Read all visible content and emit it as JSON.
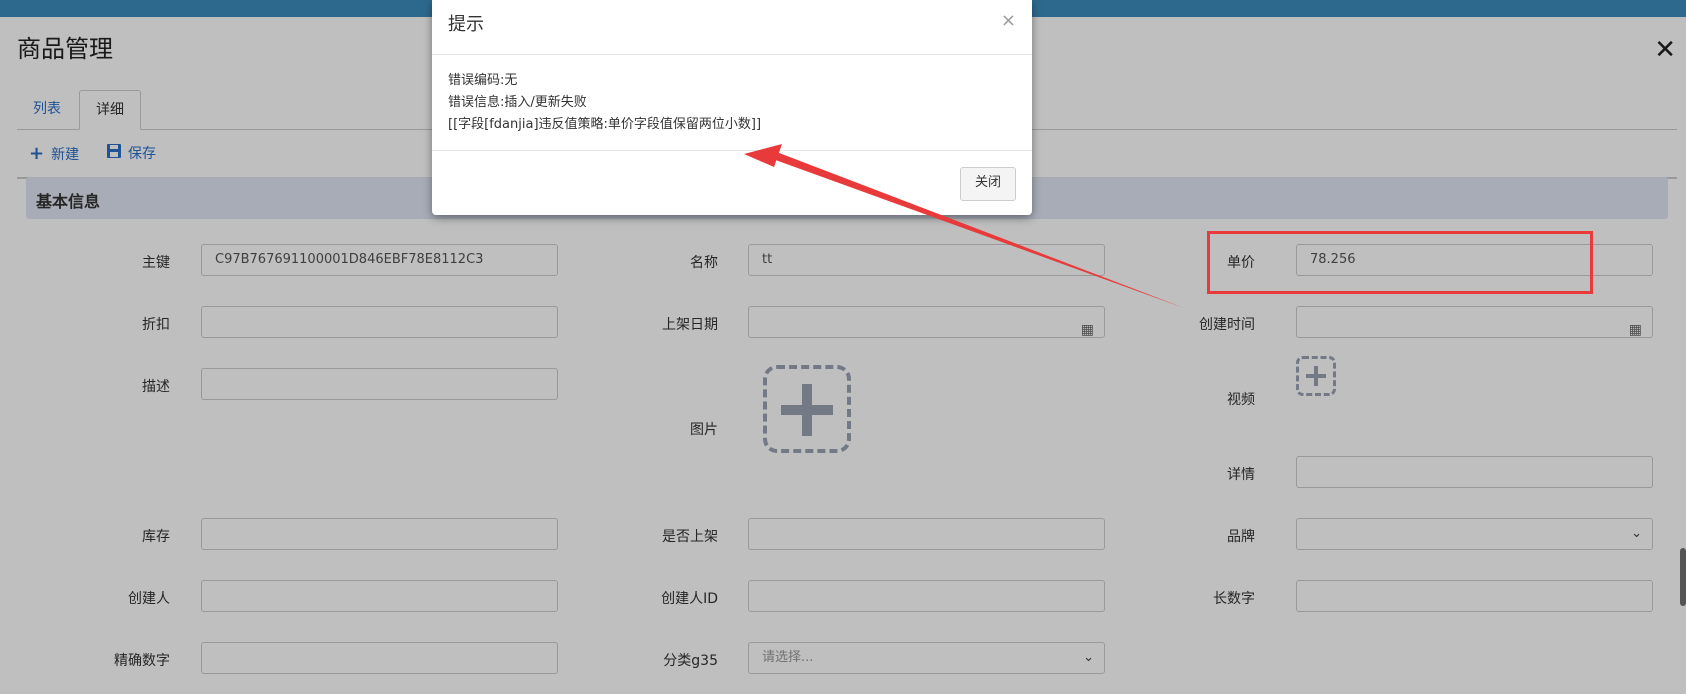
{
  "page": {
    "title": "商品管理",
    "close": "✕"
  },
  "tabs": [
    {
      "label": "列表",
      "active": false
    },
    {
      "label": "详细",
      "active": true
    }
  ],
  "toolbar": {
    "new_icon": "+",
    "new_label": "新建",
    "save_icon": "💾",
    "save_label": "保存"
  },
  "section": {
    "title": "基本信息"
  },
  "fields": {
    "id": {
      "label": "主键",
      "value": "C97B767691100001D846EBF78E8112C3"
    },
    "name": {
      "label": "名称",
      "value": "tt"
    },
    "price": {
      "label": "单价",
      "value": "78.256"
    },
    "discount": {
      "label": "折扣",
      "value": ""
    },
    "shelf_date": {
      "label": "上架日期",
      "value": ""
    },
    "create_time": {
      "label": "创建时间",
      "value": ""
    },
    "description": {
      "label": "描述",
      "value": ""
    },
    "image": {
      "label": "图片"
    },
    "video": {
      "label": "视频"
    },
    "details": {
      "label": "详情",
      "value": ""
    },
    "stock": {
      "label": "库存",
      "value": ""
    },
    "on_shelf": {
      "label": "是否上架",
      "value": ""
    },
    "brand": {
      "label": "品牌",
      "value": ""
    },
    "creator": {
      "label": "创建人",
      "value": ""
    },
    "creator_id": {
      "label": "创建人ID",
      "value": ""
    },
    "long_number": {
      "label": "长数字",
      "value": ""
    },
    "precise_number": {
      "label": "精确数字",
      "value": ""
    },
    "category": {
      "label": "分类g35",
      "placeholder": "请选择..."
    }
  },
  "modal": {
    "title": "提示",
    "close": "×",
    "lines": [
      "错误编码:无",
      "错误信息:插入/更新失败",
      "[[字段[fdanjia]违反值策略:单价字段值保留两位小数]]"
    ],
    "button": "关闭"
  },
  "icons": {
    "calendar": "calendar-icon",
    "dropdown": "chevron-down-icon",
    "upload": "plus-icon"
  },
  "colors": {
    "topbar": "#3c8dbc",
    "link": "#2a6fc9",
    "section_bg": "#dfe6f3",
    "annotation": "#e83a3a"
  }
}
